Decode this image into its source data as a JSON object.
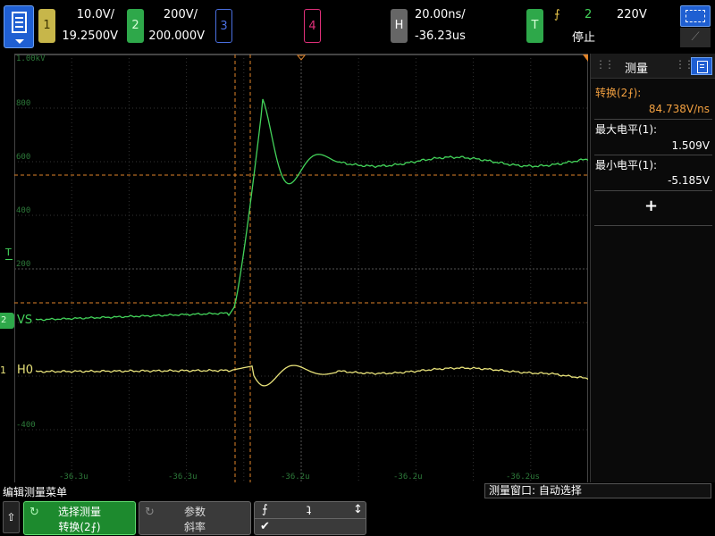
{
  "topbar": {
    "ch1": {
      "num": "1",
      "scale": "10.0V/",
      "offset": "19.2500V"
    },
    "ch2": {
      "num": "2",
      "scale": "200V/",
      "offset": "200.000V"
    },
    "ch3": {
      "num": "3"
    },
    "ch4": {
      "num": "4"
    },
    "horizontal": {
      "label": "H",
      "scale": "20.00ns/",
      "delay": "-36.23us"
    },
    "trigger": {
      "label": "T",
      "slope": "⨍",
      "source": "2",
      "level": "220V",
      "status": "停止"
    }
  },
  "plot": {
    "y_labels": [
      "1.00kV",
      "800",
      "600",
      "400",
      "200",
      "-400"
    ],
    "x_labels": [
      "-36.3u",
      "-36.3u",
      "-36.2u",
      "-36.2u",
      "-36.2us"
    ],
    "ch2_marker": "2",
    "ch2_label": "VS",
    "ch1_marker": "1",
    "ch1_label": "H0",
    "trigger_marker": "T"
  },
  "chart_data": {
    "type": "line",
    "series": [
      {
        "name": "VS",
        "color": "#43d35a"
      },
      {
        "name": "H0",
        "color": "#e8e27a"
      }
    ]
  },
  "panel": {
    "title": "测量",
    "measurements": [
      {
        "name": "转换(2⨍):",
        "value": "84.738V/ns",
        "color": "#f2a040"
      },
      {
        "name": "最大电平(1):",
        "value": "1.509V",
        "color": "#ffffff"
      },
      {
        "name": "最小电平(1):",
        "value": "-5.185V",
        "color": "#ffffff"
      }
    ],
    "add": "+"
  },
  "bottom": {
    "menu_title": "编辑测量菜单",
    "meas_window": "测量窗口: 自动选择",
    "softkeys": [
      {
        "line1": "选择测量",
        "line2": "转换(2⨍)"
      },
      {
        "line1": "参数",
        "line2": "斜率"
      }
    ],
    "edge_options": [
      "⨍",
      "ʇ",
      "↕"
    ],
    "check": "✔"
  }
}
